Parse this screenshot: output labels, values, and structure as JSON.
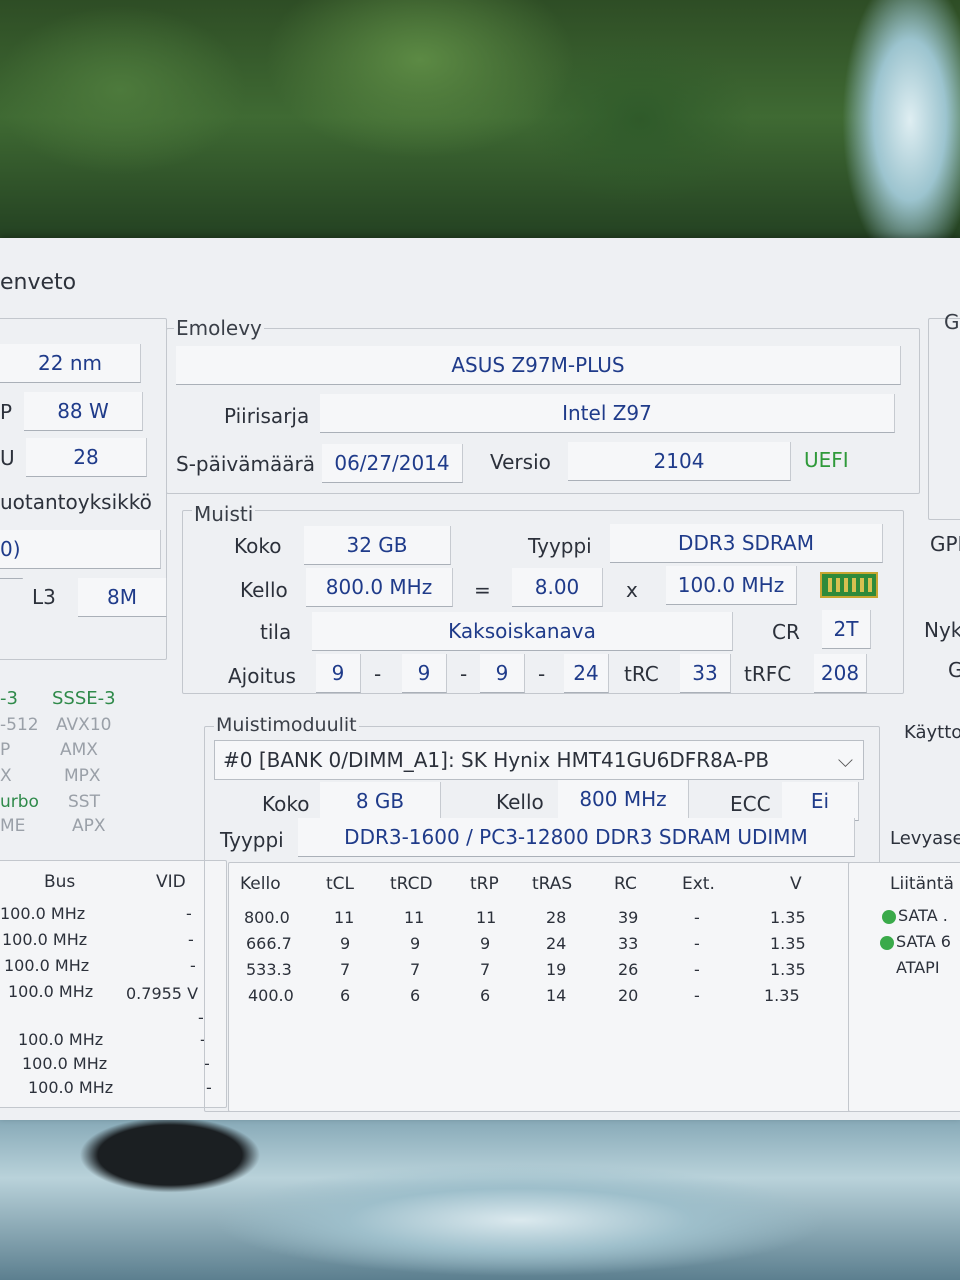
{
  "window": {
    "title_fragment": "enveto"
  },
  "left_panel": {
    "process_value": "22 nm",
    "tdp_label": "P",
    "tdp_value": "88 W",
    "revision_label": "U",
    "revision_value": "28",
    "manufacturer_label": "uotantoyksikkö",
    "model_fragment": "0)",
    "l3_label": "L3",
    "l3_value": "8M",
    "instructions": [
      {
        "a": "-3",
        "b": "SSSE-3"
      },
      {
        "a": "-512",
        "b": "AVX10"
      },
      {
        "a": "P",
        "b": "AMX"
      },
      {
        "a": "X",
        "b": "MPX"
      },
      {
        "a": "urbo",
        "b": "SST"
      },
      {
        "a": "ME",
        "b": "APX"
      }
    ],
    "clock_headers": {
      "bus": "Bus",
      "vid": "VID"
    },
    "clock_rows": [
      {
        "bus": "100.0 MHz",
        "vid": "-"
      },
      {
        "bus": "100.0 MHz",
        "vid": "-"
      },
      {
        "bus": "100.0 MHz",
        "vid": "-"
      },
      {
        "bus": "100.0 MHz",
        "vid": "0.7955 V"
      },
      {
        "bus": "",
        "vid": "-"
      },
      {
        "bus": "100.0 MHz",
        "vid": "-"
      },
      {
        "bus": "100.0 MHz",
        "vid": "-"
      },
      {
        "bus": "100.0 MHz",
        "vid": "-"
      }
    ]
  },
  "motherboard": {
    "group": "Emolevy",
    "model": "ASUS Z97M-PLUS",
    "chipset_label": "Piirisarja",
    "chipset": "Intel Z97",
    "bios_date_label": "S-päivämäärä",
    "bios_date": "06/27/2014",
    "version_label": "Versio",
    "version": "2104",
    "uefi": "UEFI"
  },
  "memory": {
    "group": "Muisti",
    "size_label": "Koko",
    "size": "32 GB",
    "type_label": "Tyyppi",
    "type": "DDR3 SDRAM",
    "clock_label": "Kello",
    "clock": "800.0 MHz",
    "equals": "=",
    "multiplier": "8.00",
    "times": "x",
    "bus": "100.0 MHz",
    "mode_label": "tila",
    "mode": "Kaksoiskanava",
    "cr_label": "CR",
    "cr": "2T",
    "timing_label": "Ajoitus",
    "timings": [
      "9",
      "9",
      "9",
      "24"
    ],
    "dash": "-",
    "trc_label": "tRC",
    "trc": "33",
    "trfc_label": "tRFC",
    "trfc": "208"
  },
  "modules": {
    "group": "Muistimoduulit",
    "selected": "#0 [BANK 0/DIMM_A1]: SK Hynix HMT41GU6DFR8A-PB",
    "size_label": "Koko",
    "size": "8 GB",
    "clock_label": "Kello",
    "clock": "800 MHz",
    "ecc_label": "ECC",
    "ecc": "Ei",
    "type_label": "Tyyppi",
    "type": "DDR3-1600 / PC3-12800 DDR3 SDRAM UDIMM",
    "table_headers": [
      "Kello",
      "tCL",
      "tRCD",
      "tRP",
      "tRAS",
      "RC",
      "Ext.",
      "V"
    ],
    "table_rows": [
      [
        "800.0",
        "11",
        "11",
        "11",
        "28",
        "39",
        "-",
        "1.35"
      ],
      [
        "666.7",
        "9",
        "9",
        "9",
        "24",
        "33",
        "-",
        "1.35"
      ],
      [
        "533.3",
        "7",
        "7",
        "7",
        "19",
        "26",
        "-",
        "1.35"
      ],
      [
        "400.0",
        "6",
        "6",
        "6",
        "14",
        "20",
        "-",
        "1.35"
      ]
    ]
  },
  "right_panel": {
    "g_label": "G",
    "gpu_label": "GPI",
    "current_label": "Nyk",
    "g2_label": "G",
    "os_label": "Käytto",
    "drives_label": "Levyase",
    "interface_label": "Liitäntä",
    "drives": [
      {
        "icon": "check-icon",
        "label": "SATA ."
      },
      {
        "icon": "check-icon",
        "label": "SATA 6"
      },
      {
        "icon": "",
        "label": "ATAPI"
      }
    ]
  }
}
